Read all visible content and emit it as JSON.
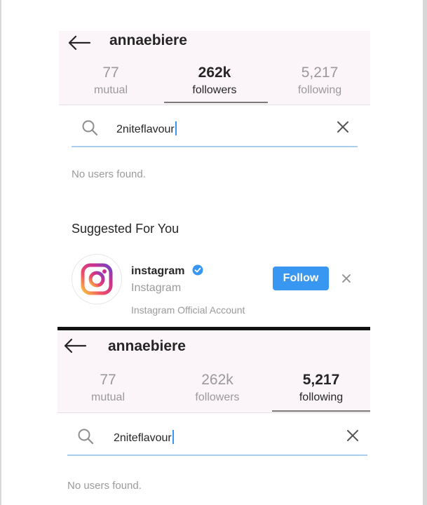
{
  "top_screen": {
    "username": "annaebiere",
    "stats": [
      {
        "value": "77",
        "label": "mutual"
      },
      {
        "value": "262k",
        "label": "followers"
      },
      {
        "value": "5,217",
        "label": "following"
      }
    ],
    "search_value": "2niteflavour",
    "empty_message": "No users found.",
    "suggested_heading": "Suggested For You",
    "suggestion": {
      "name": "instagram",
      "subtitle": "Instagram",
      "note": "Instagram Official Account",
      "follow_label": "Follow"
    }
  },
  "bottom_screen": {
    "username": "annaebiere",
    "stats": [
      {
        "value": "77",
        "label": "mutual"
      },
      {
        "value": "262k",
        "label": "followers"
      },
      {
        "value": "5,217",
        "label": "following"
      }
    ],
    "search_value": "2niteflavour",
    "empty_message": "No users found."
  },
  "colors": {
    "accent": "#3897f0",
    "header_bg": "#fbf4f8",
    "muted_text": "#9a9a9a"
  },
  "icons": [
    "back-arrow-icon",
    "search-icon",
    "close-icon",
    "verified-badge-icon",
    "instagram-logo-icon"
  ]
}
